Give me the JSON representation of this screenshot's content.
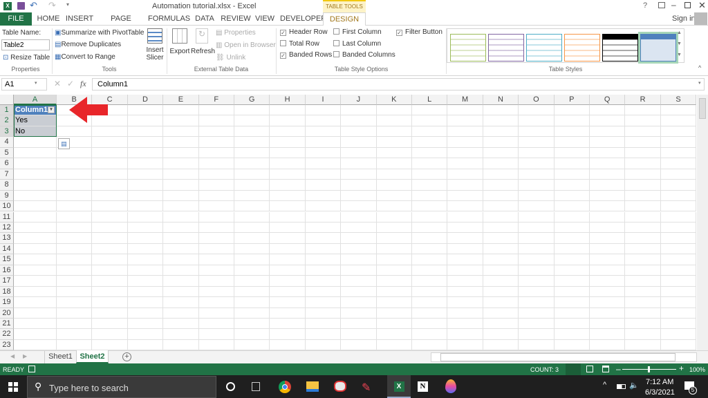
{
  "window": {
    "title": "Automation tutorial.xlsx - Excel",
    "contextual": "TABLE TOOLS",
    "sign_in": "Sign in",
    "help": "?"
  },
  "tabs": [
    "FILE",
    "HOME",
    "INSERT",
    "PAGE LAYOUT",
    "FORMULAS",
    "DATA",
    "REVIEW",
    "VIEW",
    "DEVELOPER",
    "DESIGN"
  ],
  "ribbon": {
    "properties": {
      "table_name_label": "Table Name:",
      "table_name_value": "Table2",
      "resize": "Resize Table",
      "group": "Properties"
    },
    "tools": {
      "summarize": "Summarize with PivotTable",
      "remove_dup": "Remove Duplicates",
      "convert": "Convert to Range",
      "insert_slicer": "Insert",
      "insert_slicer2": "Slicer",
      "group": "Tools"
    },
    "external": {
      "export": "Export",
      "refresh": "Refresh",
      "properties": "Properties",
      "open_browser": "Open in Browser",
      "unlink": "Unlink",
      "group": "External Table Data"
    },
    "options": {
      "header_row": "Header Row",
      "total_row": "Total Row",
      "banded_rows": "Banded Rows",
      "first_column": "First Column",
      "last_column": "Last Column",
      "banded_columns": "Banded Columns",
      "filter_button": "Filter Button",
      "group": "Table Style Options",
      "checked": {
        "header_row": true,
        "total_row": false,
        "banded_rows": true,
        "first_column": false,
        "last_column": false,
        "banded_columns": false,
        "filter_button": true
      }
    },
    "styles": {
      "group": "Table Styles",
      "colors": [
        "#9bbb59",
        "#8064a2",
        "#4bacc6",
        "#f79646",
        "#000000",
        "#4f81bd"
      ],
      "selected": 5
    }
  },
  "formula": {
    "name_box": "A1",
    "fx": "fx",
    "value": "Column1"
  },
  "columns": [
    "A",
    "B",
    "C",
    "D",
    "E",
    "F",
    "G",
    "H",
    "I",
    "J",
    "K",
    "L",
    "M",
    "N",
    "O",
    "P",
    "Q",
    "R",
    "S"
  ],
  "rows": [
    "1",
    "2",
    "3",
    "4",
    "5",
    "6",
    "7",
    "8",
    "9",
    "10",
    "11",
    "12",
    "13",
    "14",
    "15",
    "16",
    "17",
    "18",
    "19",
    "20",
    "21",
    "22",
    "23"
  ],
  "cells": {
    "A1": "Column1",
    "A2": "Yes",
    "A3": "No"
  },
  "sheets": [
    "Sheet1",
    "Sheet2"
  ],
  "active_sheet": "Sheet2",
  "status": {
    "mode": "READY",
    "count": "COUNT: 3",
    "zoom": "100%",
    "zoom_level": 100
  },
  "taskbar": {
    "search": "Type here to search",
    "time": "7:12 AM",
    "date": "6/3/2021",
    "notifications": "5"
  },
  "colors": {
    "excel_green": "#217346",
    "header_blue": "#4f81bd",
    "band": "#c9cdd3",
    "arrow": "#e8262a"
  }
}
